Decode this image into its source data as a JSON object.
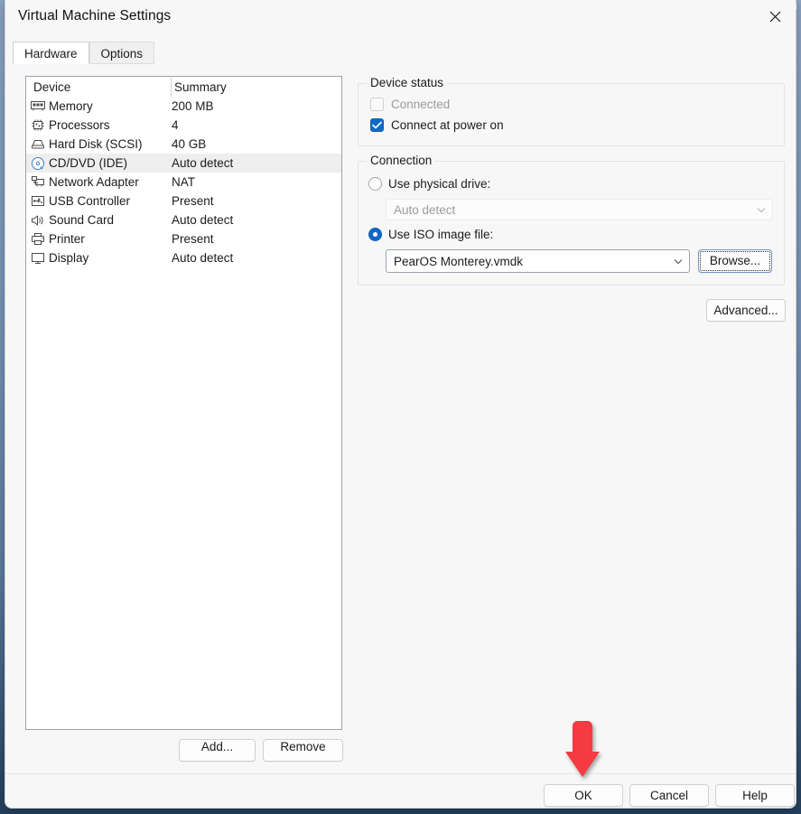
{
  "window": {
    "title": "Virtual Machine Settings",
    "close_icon": "close-icon"
  },
  "tabs": [
    {
      "label": "Hardware",
      "active": true
    },
    {
      "label": "Options",
      "active": false
    }
  ],
  "device_list": {
    "columns": [
      "Device",
      "Summary"
    ],
    "rows": [
      {
        "icon": "memory-icon",
        "name": "Memory",
        "summary": "200 MB",
        "selected": false
      },
      {
        "icon": "processor-icon",
        "name": "Processors",
        "summary": "4",
        "selected": false
      },
      {
        "icon": "hard-disk-icon",
        "name": "Hard Disk (SCSI)",
        "summary": "40 GB",
        "selected": false
      },
      {
        "icon": "cd-dvd-icon",
        "name": "CD/DVD (IDE)",
        "summary": "Auto detect",
        "selected": true
      },
      {
        "icon": "network-adapter-icon",
        "name": "Network Adapter",
        "summary": "NAT",
        "selected": false
      },
      {
        "icon": "usb-controller-icon",
        "name": "USB Controller",
        "summary": "Present",
        "selected": false
      },
      {
        "icon": "sound-card-icon",
        "name": "Sound Card",
        "summary": "Auto detect",
        "selected": false
      },
      {
        "icon": "printer-icon",
        "name": "Printer",
        "summary": "Present",
        "selected": false
      },
      {
        "icon": "display-icon",
        "name": "Display",
        "summary": "Auto detect",
        "selected": false
      }
    ],
    "add_label": "Add...",
    "remove_label": "Remove"
  },
  "device_status": {
    "legend": "Device status",
    "connected": {
      "label": "Connected",
      "checked": false,
      "disabled": true
    },
    "connect_at_power_on": {
      "label": "Connect at power on",
      "checked": true,
      "disabled": false
    }
  },
  "connection": {
    "legend": "Connection",
    "use_physical_drive": {
      "label": "Use physical drive:",
      "selected": false
    },
    "physical_drive_value": "Auto detect",
    "use_iso_image": {
      "label": "Use ISO image file:",
      "selected": true
    },
    "iso_value": "PearOS Monterey.vmdk",
    "browse_label": "Browse...",
    "advanced_label": "Advanced..."
  },
  "footer": {
    "ok_label": "OK",
    "cancel_label": "Cancel",
    "help_label": "Help"
  },
  "annotation": {
    "arrow_color": "#F43B42",
    "points_at": "ok-button"
  },
  "colors": {
    "accent": "#1069c6",
    "selection": "#eeeeee",
    "disabled_text": "#9b9b9b"
  }
}
